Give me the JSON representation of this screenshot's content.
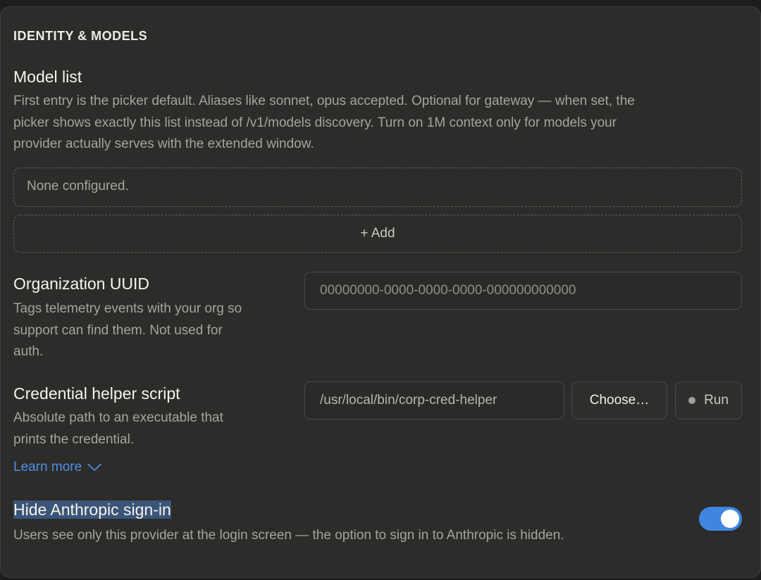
{
  "section": {
    "title": "IDENTITY & MODELS"
  },
  "model_list": {
    "label": "Model list",
    "description_lines": [
      "First entry is the picker default. Aliases like sonnet, opus accepted. Optional for gateway — when set, the",
      "picker shows exactly this list instead of /v1/models discovery. Turn on 1M context only for models your",
      "provider actually serves with the extended window."
    ],
    "empty_text": "None configured.",
    "add_label": "+ Add"
  },
  "org_uuid": {
    "label": "Organization UUID",
    "description_lines": [
      "Tags telemetry events with your org so",
      "support can find them. Not used for",
      "auth."
    ],
    "placeholder": "00000000-0000-0000-0000-000000000000"
  },
  "credential_helper": {
    "label": "Credential helper script",
    "description_lines": [
      "Absolute path to an executable that",
      "prints the credential."
    ],
    "value": "/usr/local/bin/corp-cred-helper",
    "choose_label": "Choose…",
    "run_label": "Run",
    "learn_more_label": "Learn more"
  },
  "hide_signin": {
    "label": "Hide Anthropic sign-in",
    "description": "Users see only this provider at the login screen — the option to sign in to Anthropic is hidden.",
    "toggle_on": true
  },
  "colors": {
    "accent": "#3f86e0",
    "link": "#4f8ee0",
    "panel_bg": "#2c2c2b",
    "selection": "#3a5578"
  },
  "icons": {
    "learn_more": "chevron-down-icon",
    "run_status": "status-dot-icon"
  }
}
